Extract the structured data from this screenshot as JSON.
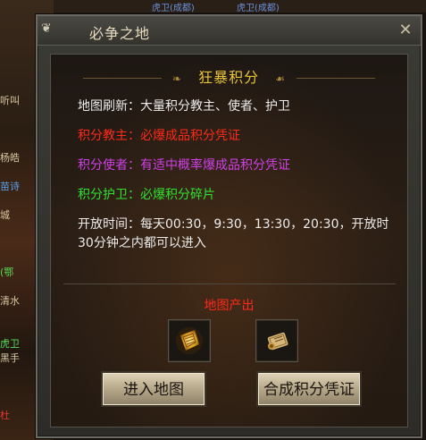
{
  "background": {
    "left_labels": [
      {
        "text": "听叫",
        "kind": "normal"
      },
      {
        "text": "杨皓",
        "kind": "normal"
      },
      {
        "text": "苗诗",
        "kind": "blue"
      },
      {
        "text": "城",
        "kind": "normal"
      },
      {
        "text": "(鄂",
        "kind": "green"
      },
      {
        "text": "清水",
        "kind": "normal"
      },
      {
        "text": "虎卫",
        "kind": "green"
      },
      {
        "text": "黑手",
        "kind": "normal"
      },
      {
        "text": "杜",
        "kind": "red"
      }
    ],
    "top_labels": [
      "虎卫(成都)",
      "虎卫(成都)"
    ]
  },
  "window": {
    "title": "必争之地",
    "title_deco": "❦",
    "close_label": "✕"
  },
  "section": {
    "title": "狂暴积分",
    "left_ornament": "❧",
    "right_ornament": "☙"
  },
  "rows": {
    "refresh": "地图刷新：大量积分教主、使者、护卫",
    "leader": "积分教主：必爆成品积分凭证",
    "envoy": "积分使者：有适中概率爆成品积分凭证",
    "guard": "积分护卫：必爆积分碎片",
    "open": "开放时间：每天00:30，9:30，13:30，20:30，开放时30分钟之内都可以进入"
  },
  "output": {
    "title": "地图产出",
    "items": [
      {
        "name": "积分碎片",
        "icon": "scroll-shard-icon"
      },
      {
        "name": "积分凭证",
        "icon": "scroll-voucher-icon"
      }
    ]
  },
  "buttons": {
    "enter": "进入地图",
    "synthesize": "合成积分凭证"
  },
  "colors": {
    "accent_gold": "#e8c238",
    "leader_red": "#ff2a1a",
    "envoy_magenta": "#d040e8",
    "guard_green": "#30e030"
  }
}
